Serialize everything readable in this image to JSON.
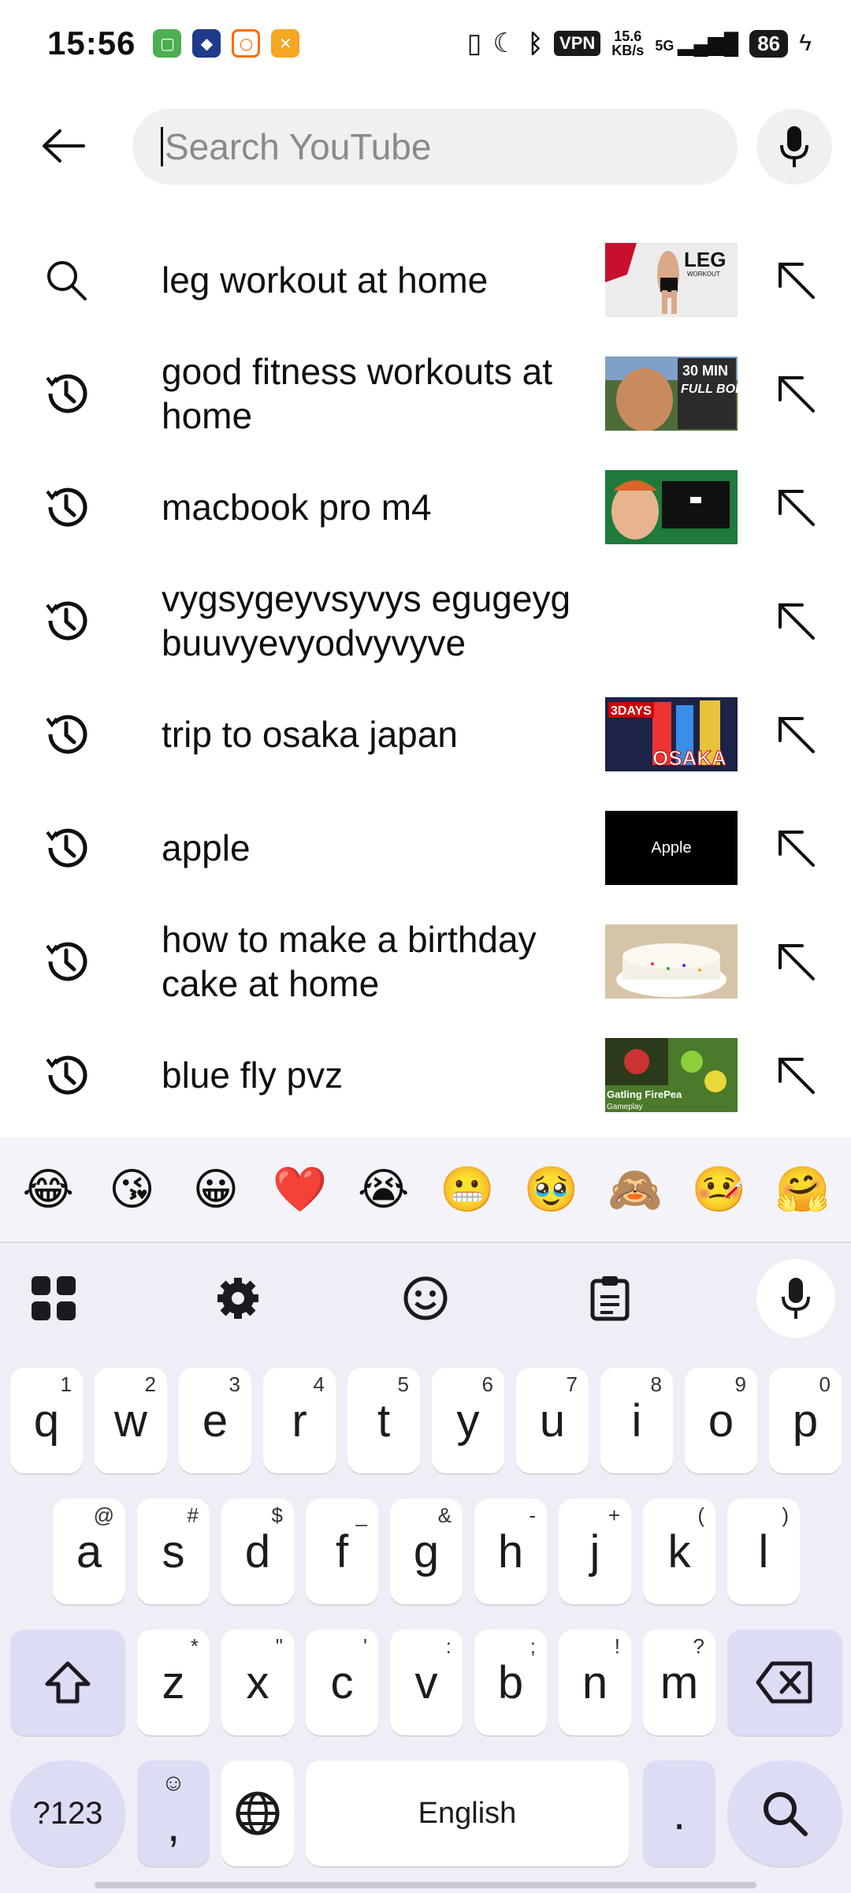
{
  "status_bar": {
    "time": "15:56",
    "vpn": "VPN",
    "speed_value": "15.6",
    "speed_unit": "KB/s",
    "network": "5G",
    "battery": "86"
  },
  "search": {
    "placeholder": "Search YouTube"
  },
  "suggestions": [
    {
      "text": "leg workout at home",
      "type": "search",
      "thumb_label": "LEG",
      "thumb_sub": "WORKOUT",
      "thumb_color": "#e8e8e8"
    },
    {
      "text": "good fitness workouts at home",
      "type": "history",
      "thumb_label": "30 MIN",
      "thumb_sub": "FULL BODY",
      "thumb_color": "#3a5a2e"
    },
    {
      "text": "macbook pro m4",
      "type": "history",
      "thumb_label": "",
      "thumb_sub": "",
      "thumb_color": "#1e7a3e"
    },
    {
      "text": "vygsygeyvsyvys egugeyg buuvyevyodvyvyve",
      "type": "history",
      "thumb_label": "",
      "thumb_sub": "",
      "thumb_color": ""
    },
    {
      "text": "trip to osaka japan",
      "type": "history",
      "thumb_label": "3DAYS",
      "thumb_sub": "OSAKA",
      "thumb_color": "#222244"
    },
    {
      "text": "apple",
      "type": "history",
      "thumb_label": "Apple",
      "thumb_sub": "",
      "thumb_color": "#000000"
    },
    {
      "text": "how to make a birthday cake at home",
      "type": "history",
      "thumb_label": "",
      "thumb_sub": "",
      "thumb_color": "#d9c7ae"
    },
    {
      "text": "blue fly pvz",
      "type": "history",
      "thumb_label": "Gatling FirePea",
      "thumb_sub": "",
      "thumb_color": "#4a7a2a"
    }
  ],
  "emoji_row": [
    "😂",
    "😘",
    "😀",
    "❤️",
    "😭",
    "😬",
    "🥹",
    "🙈",
    "🤒",
    "🤗"
  ],
  "keyboard": {
    "row1": [
      {
        "k": "q",
        "h": "1"
      },
      {
        "k": "w",
        "h": "2"
      },
      {
        "k": "e",
        "h": "3"
      },
      {
        "k": "r",
        "h": "4"
      },
      {
        "k": "t",
        "h": "5"
      },
      {
        "k": "y",
        "h": "6"
      },
      {
        "k": "u",
        "h": "7"
      },
      {
        "k": "i",
        "h": "8"
      },
      {
        "k": "o",
        "h": "9"
      },
      {
        "k": "p",
        "h": "0"
      }
    ],
    "row2": [
      {
        "k": "a",
        "h": "@"
      },
      {
        "k": "s",
        "h": "#"
      },
      {
        "k": "d",
        "h": "$"
      },
      {
        "k": "f",
        "h": "_"
      },
      {
        "k": "g",
        "h": "&"
      },
      {
        "k": "h",
        "h": "-"
      },
      {
        "k": "j",
        "h": "+"
      },
      {
        "k": "k",
        "h": "("
      },
      {
        "k": "l",
        "h": ")"
      }
    ],
    "row3": [
      {
        "k": "z",
        "h": "*"
      },
      {
        "k": "x",
        "h": "\""
      },
      {
        "k": "c",
        "h": "'"
      },
      {
        "k": "v",
        "h": ":"
      },
      {
        "k": "b",
        "h": ";"
      },
      {
        "k": "n",
        "h": "!"
      },
      {
        "k": "m",
        "h": "?"
      }
    ],
    "symbols_label": "?123",
    "comma_label": ",",
    "space_label": "English",
    "period_label": "."
  },
  "colors": {
    "accent": "#dcdcf5",
    "keyboard_bg": "#eeeef6"
  }
}
